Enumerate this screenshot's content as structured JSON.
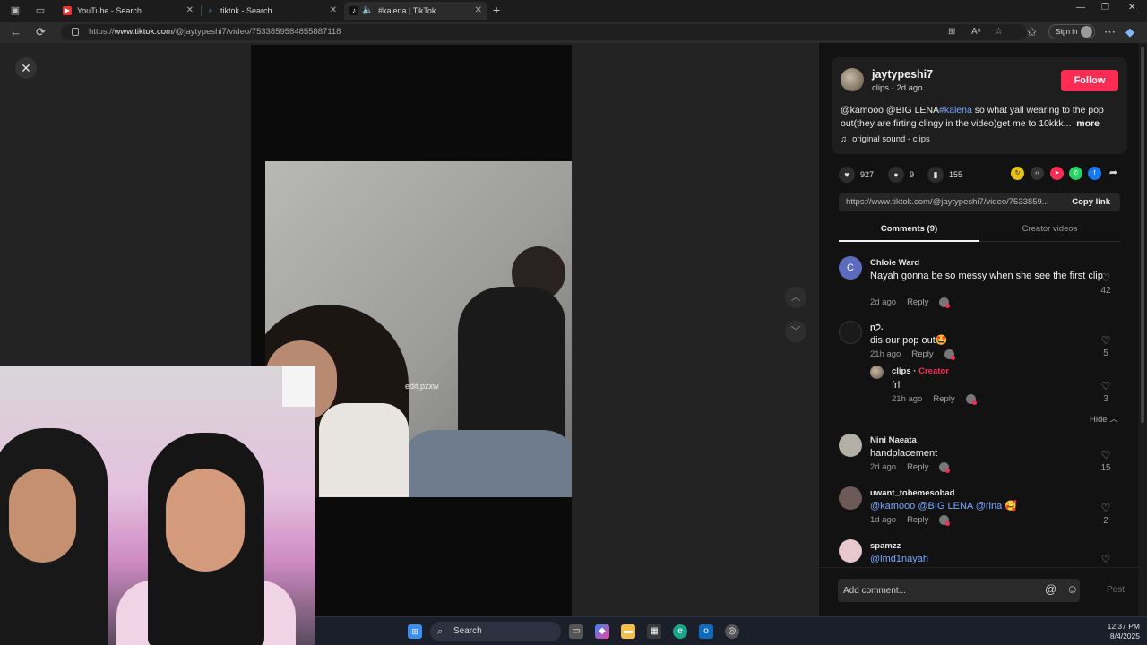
{
  "browser": {
    "tabs": [
      {
        "title": "YouTube - Search",
        "icon": "youtube-icon"
      },
      {
        "title": "tiktok - Search",
        "icon": "search-icon"
      },
      {
        "title": "#kalena | TikTok",
        "icon": "tiktok-icon",
        "active": true
      }
    ],
    "url_prefix": "https://",
    "url_domain": "www.tiktok.com",
    "url_path": "/@jaytypeshi7/video/7533859584855887118",
    "signin_label": "Sign in"
  },
  "video": {
    "overlay_text": "edit.pzxw"
  },
  "post": {
    "author": "jaytypeshi7",
    "meta": "clips · 2d ago",
    "follow_label": "Follow",
    "caption_start": "@kamooo @BIG LENA",
    "caption_tag": "#kalena",
    "caption_rest": " so what yall wearing to the pop out(they are firting clingy in the video)get me to 10kkk...",
    "caption_more": "more",
    "sound": "original sound - clips",
    "likes": "927",
    "comments_count": "9",
    "saves": "155",
    "share_link": "https://www.tiktok.com/@jaytypeshi7/video/7533859...",
    "copy_label": "Copy link"
  },
  "comment_tabs": {
    "comments": "Comments (9)",
    "creator": "Creator videos"
  },
  "comments": [
    {
      "name": "Chloie Ward",
      "avatar_letter": "C",
      "text": "Nayah gonna be so messy when she see the first clip",
      "time": "2d ago",
      "reply": "Reply",
      "likes": "42"
    },
    {
      "name": "ɲ੭.",
      "text": "dis our pop out🤩",
      "time": "21h ago",
      "reply": "Reply",
      "likes": "5"
    },
    {
      "name": "clips",
      "creator_tag": "Creator",
      "text": "frl",
      "time": "21h ago",
      "reply": "Reply",
      "likes": "3"
    },
    {
      "name": "Nini Naeata",
      "text": "handplacement",
      "time": "2d ago",
      "reply": "Reply",
      "likes": "15"
    },
    {
      "name": "uwant_tobemesobad",
      "text": "@kamooo @BIG LENA @rina 🥰",
      "time": "1d ago",
      "reply": "Reply",
      "likes": "2"
    },
    {
      "name": "spamzz",
      "text": "@lmd1nayah"
    }
  ],
  "hide_label": "Hide",
  "comment_input": {
    "placeholder": "Add comment...",
    "post_label": "Post"
  },
  "taskbar": {
    "search_label": "Search",
    "time": "12:37 PM",
    "date": "8/4/2025"
  },
  "colors": {
    "accent": "#fe2c55",
    "mention": "#79a7ff"
  }
}
